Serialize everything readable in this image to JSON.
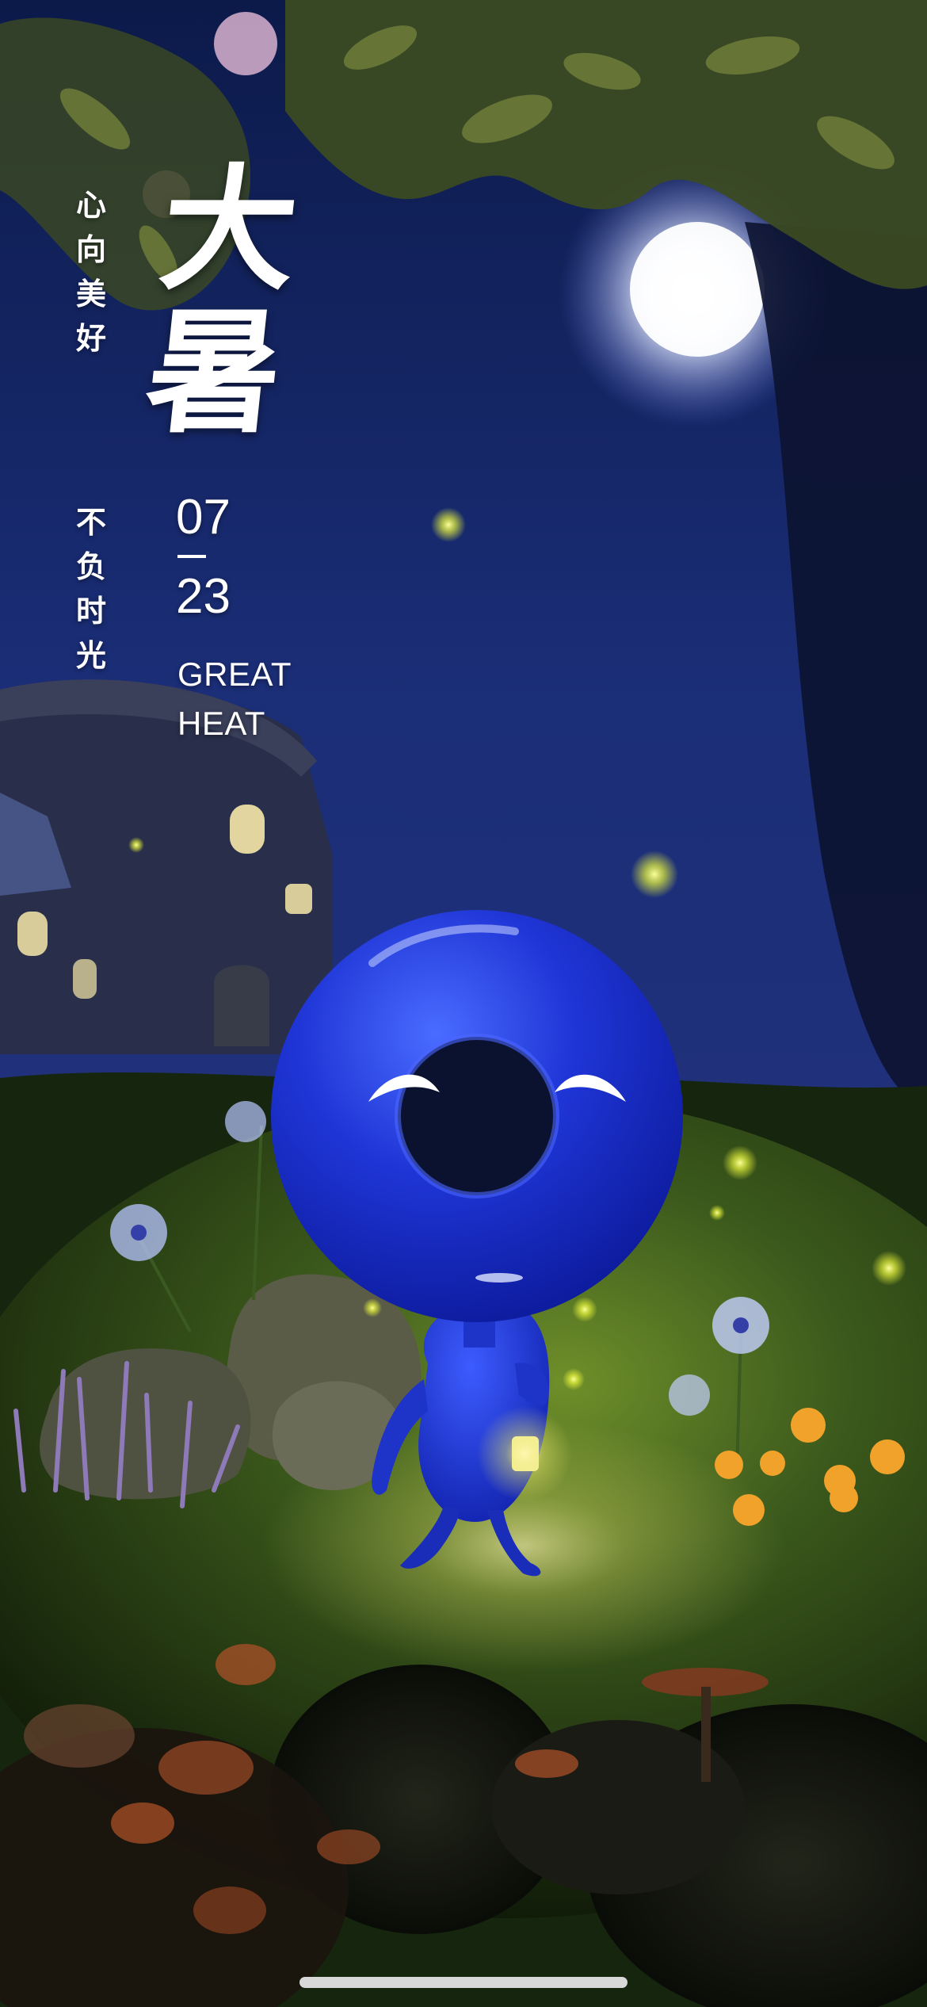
{
  "poster": {
    "term_name": "大暑",
    "motto_line1": [
      "心",
      "向",
      "美",
      "好"
    ],
    "motto_line2": [
      "不",
      "负",
      "时",
      "光"
    ],
    "date_month": "07",
    "date_day": "23",
    "english_line1": "GREAT",
    "english_line2": "HEAT"
  },
  "colors": {
    "sky": "#1a2a6e",
    "mascot_blue": "#1f35d6",
    "grass": "#3a5a1e",
    "firefly": "#f2ff4a",
    "text": "#ffffff"
  },
  "icons": {
    "mascot": "blue-donut-character-icon",
    "lantern": "lantern-icon"
  }
}
